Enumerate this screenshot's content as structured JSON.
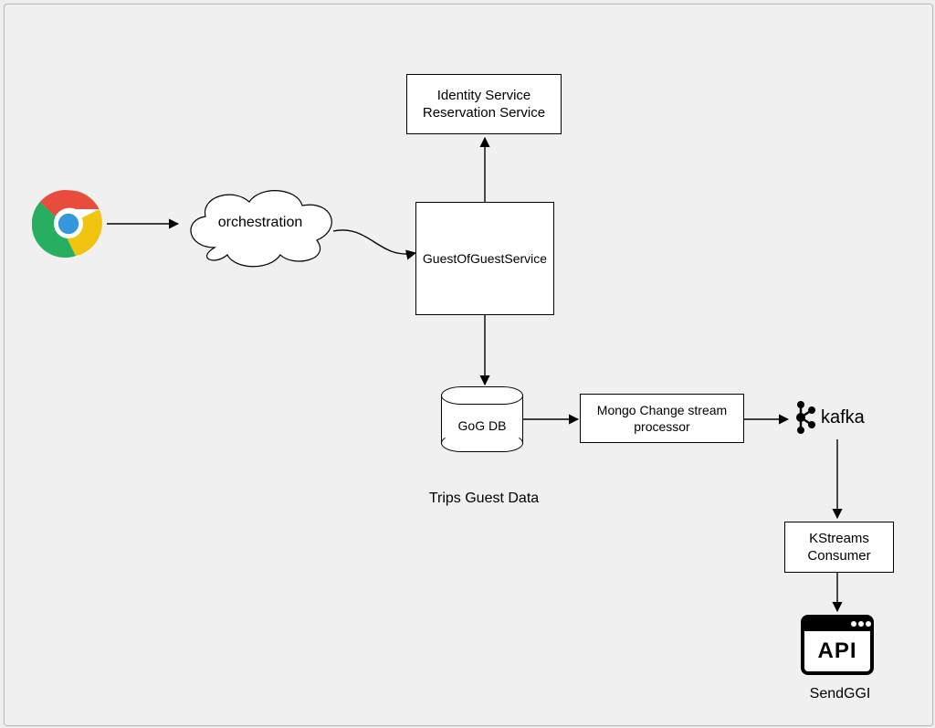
{
  "nodes": {
    "identity": {
      "line1": "Identity Service",
      "line2": "Reservation Service"
    },
    "orchestration": "orchestration",
    "gog_service": "GuestOfGuestService",
    "gog_db": "GoG DB",
    "trips_guest_data": "Trips Guest Data",
    "mongo_processor": {
      "line1": "Mongo Change stream",
      "line2": "processor"
    },
    "kafka": "kafka",
    "kstreams": {
      "line1": "KStreams",
      "line2": "Consumer"
    },
    "api_label": "API",
    "sendggi": "SendGGI"
  }
}
